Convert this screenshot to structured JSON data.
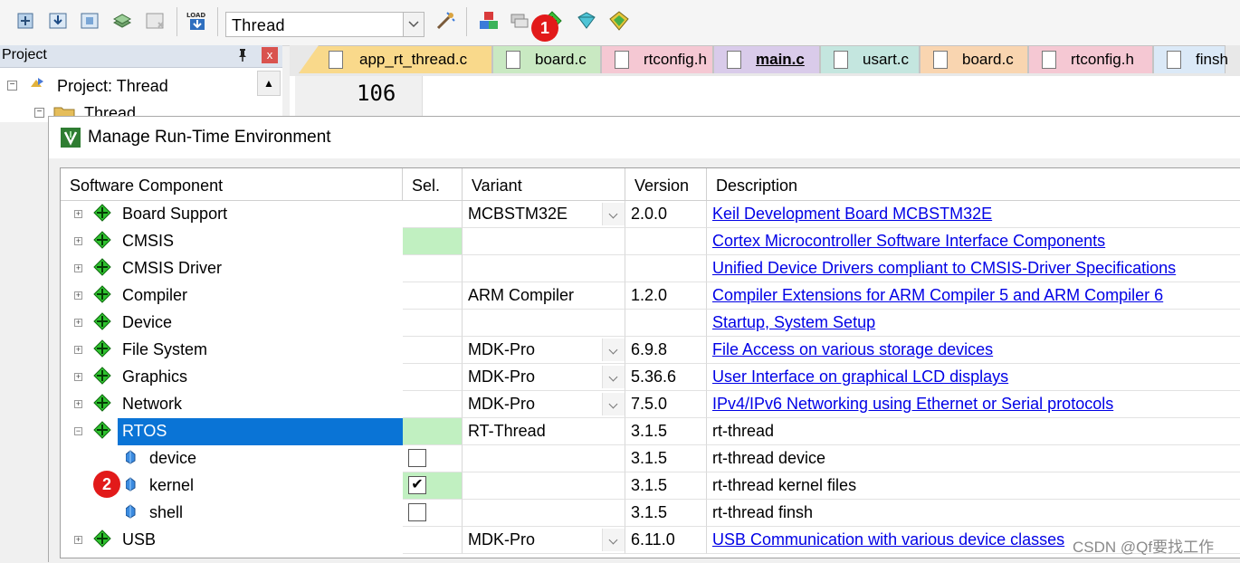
{
  "toolbar": {
    "target_name": "Thread",
    "target_name_hint": "target-select",
    "icons": [
      "translate-icon",
      "build-icon",
      "rebuild-icon",
      "batch-build-icon",
      "stop-build-icon",
      "download-icon",
      "target-options-icon",
      "pack-installer-icon",
      "manage-project-items-icon",
      "manage-rte-icon",
      "select-packs-icon"
    ],
    "load_label": "LOAD"
  },
  "badges": [
    "1",
    "2"
  ],
  "project_panel": {
    "title": "Project",
    "pin_glyph": "ᵖ",
    "close_glyph": "x",
    "tree": [
      {
        "label": "Project: Thread",
        "expander": "−"
      },
      {
        "label": "Thread",
        "expander": "−"
      }
    ]
  },
  "tabs": [
    {
      "label": "app_rt_thread.c",
      "color": "#f9d98b",
      "active": false
    },
    {
      "label": "board.c",
      "color": "#c9e9c2",
      "active": false
    },
    {
      "label": "rtconfig.h",
      "color": "#f5c8d3",
      "active": false
    },
    {
      "label": "main.c",
      "color": "#d9cbea",
      "active": true
    },
    {
      "label": "usart.c",
      "color": "#c4e6df",
      "active": false
    },
    {
      "label": "board.c",
      "color": "#f9d5b0",
      "active": false
    },
    {
      "label": "rtconfig.h",
      "color": "#f5c8d3",
      "active": false
    },
    {
      "label": "finsh",
      "color": "#dbe9f7",
      "active": false
    }
  ],
  "editor": {
    "line_number": "106"
  },
  "dialog": {
    "title": "Manage Run-Time Environment",
    "icon_label": "RTE",
    "columns": [
      "Software Component",
      "Sel.",
      "Variant",
      "Version",
      "Description"
    ],
    "rows": [
      {
        "component": "Board Support",
        "level": 0,
        "expander": "+",
        "selected": false,
        "sel_state": "none",
        "variant": "MCBSTM32E",
        "variant_dropdown": true,
        "version": "2.0.0",
        "description": "Keil Development Board MCBSTM32E",
        "desc_link": true
      },
      {
        "component": "CMSIS",
        "level": 0,
        "expander": "+",
        "selected": false,
        "sel_state": "green",
        "variant": "",
        "variant_dropdown": false,
        "version": "",
        "description": "Cortex Microcontroller Software Interface Components",
        "desc_link": true
      },
      {
        "component": "CMSIS Driver",
        "level": 0,
        "expander": "+",
        "selected": false,
        "sel_state": "none",
        "variant": "",
        "variant_dropdown": false,
        "version": "",
        "description": "Unified Device Drivers compliant to CMSIS-Driver Specifications",
        "desc_link": true
      },
      {
        "component": "Compiler",
        "level": 0,
        "expander": "+",
        "selected": false,
        "sel_state": "none",
        "variant": "ARM Compiler",
        "variant_dropdown": false,
        "version": "1.2.0",
        "description": "Compiler Extensions for ARM Compiler 5 and ARM Compiler 6",
        "desc_link": true
      },
      {
        "component": "Device",
        "level": 0,
        "expander": "+",
        "selected": false,
        "sel_state": "none",
        "variant": "",
        "variant_dropdown": false,
        "version": "",
        "description": "Startup, System Setup",
        "desc_link": true
      },
      {
        "component": "File System",
        "level": 0,
        "expander": "+",
        "selected": false,
        "sel_state": "none",
        "variant": "MDK-Pro",
        "variant_dropdown": true,
        "version": "6.9.8",
        "description": "File Access on various storage devices",
        "desc_link": true
      },
      {
        "component": "Graphics",
        "level": 0,
        "expander": "+",
        "selected": false,
        "sel_state": "none",
        "variant": "MDK-Pro",
        "variant_dropdown": true,
        "version": "5.36.6",
        "description": "User Interface on graphical LCD displays",
        "desc_link": true
      },
      {
        "component": "Network",
        "level": 0,
        "expander": "+",
        "selected": false,
        "sel_state": "none",
        "variant": "MDK-Pro",
        "variant_dropdown": true,
        "version": "7.5.0",
        "description": "IPv4/IPv6 Networking using Ethernet or Serial protocols",
        "desc_link": true
      },
      {
        "component": "RTOS",
        "level": 0,
        "expander": "−",
        "selected": true,
        "sel_state": "green",
        "variant": "RT-Thread",
        "variant_dropdown": false,
        "version": "3.1.5",
        "description": "rt-thread",
        "desc_link": false
      },
      {
        "component": "device",
        "level": 1,
        "expander": "",
        "selected": false,
        "sel_state": "checkbox",
        "checked": false,
        "variant": "",
        "variant_dropdown": false,
        "version": "3.1.5",
        "description": "rt-thread device",
        "desc_link": false
      },
      {
        "component": "kernel",
        "level": 1,
        "expander": "",
        "selected": false,
        "sel_state": "checkbox-green",
        "checked": true,
        "variant": "",
        "variant_dropdown": false,
        "version": "3.1.5",
        "description": "rt-thread kernel files",
        "desc_link": false
      },
      {
        "component": "shell",
        "level": 1,
        "expander": "",
        "selected": false,
        "sel_state": "checkbox",
        "checked": false,
        "variant": "",
        "variant_dropdown": false,
        "version": "3.1.5",
        "description": "rt-thread finsh",
        "desc_link": false
      },
      {
        "component": "USB",
        "level": 0,
        "expander": "+",
        "selected": false,
        "sel_state": "none",
        "variant": "MDK-Pro",
        "variant_dropdown": true,
        "version": "6.11.0",
        "description": "USB Communication with various device classes",
        "desc_link": true
      }
    ],
    "check_glyph": "✔"
  },
  "watermark": "CSDN @Qf要找工作",
  "colors": {
    "selection": "#0a74d6",
    "sel_green": "#c1f0c1",
    "link": "#0000e6",
    "badge": "#e21a1a"
  }
}
